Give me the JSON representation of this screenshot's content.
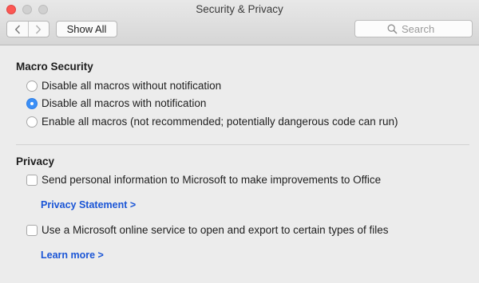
{
  "window": {
    "title": "Security & Privacy"
  },
  "toolbar": {
    "show_all_label": "Show All",
    "search_placeholder": "Search"
  },
  "macro_security": {
    "heading": "Macro Security",
    "options": [
      {
        "label": "Disable all macros without notification",
        "selected": false
      },
      {
        "label": "Disable all macros with notification",
        "selected": true
      },
      {
        "label": "Enable all macros (not recommended; potentially dangerous code can run)",
        "selected": false
      }
    ]
  },
  "privacy": {
    "heading": "Privacy",
    "items": [
      {
        "label": "Send personal information to Microsoft to make improvements to Office",
        "checked": false,
        "link": "Privacy Statement >"
      },
      {
        "label": "Use a Microsoft online service to open and export to certain types of files",
        "checked": false,
        "link": "Learn more >"
      }
    ]
  },
  "colors": {
    "accent": "#3b8ff6",
    "link": "#1a55d6",
    "close_button": "#fc5753"
  }
}
